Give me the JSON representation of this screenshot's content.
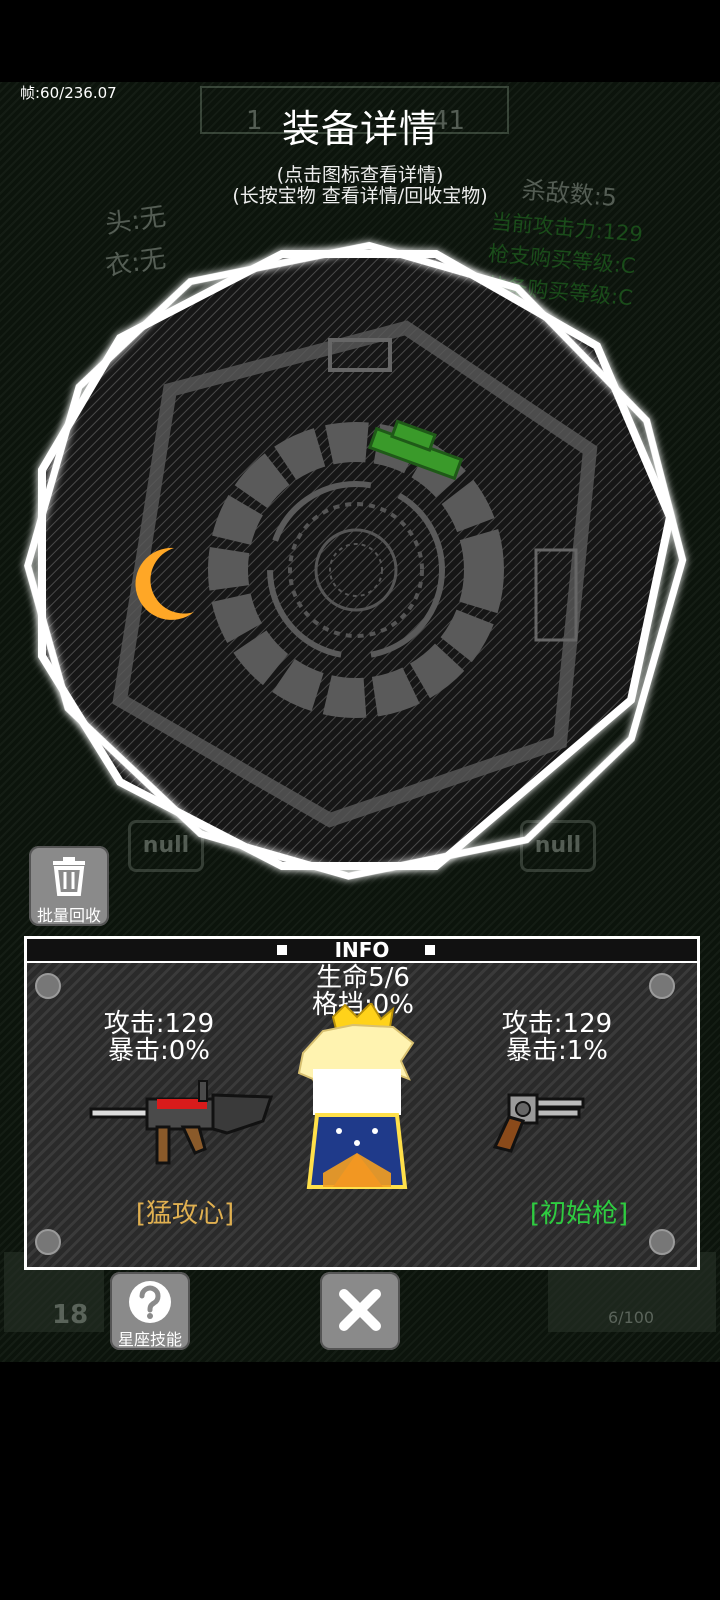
{
  "fps_text": "帧:60/236.07",
  "title": "装备详情",
  "hints": [
    "(点击图标查看详情)",
    "(长按宝物 查看详情/回收宝物)"
  ],
  "background": {
    "top_stats": [
      "1",
      "41"
    ],
    "head_label": "头:无",
    "cloth_label": "衣:无",
    "kill_count": "杀敌数:5",
    "attack_power": "当前攻击力:129",
    "gun_upgrade": "枪支购买等级:C",
    "equip_upgrade": "装备购买等级:C",
    "slot_labels": [
      "null",
      "null",
      "null"
    ],
    "ammo_count": "18",
    "progress": "6/100"
  },
  "recycle_button": {
    "label": "批量回收",
    "icon": "trash-icon"
  },
  "info": {
    "title": "INFO",
    "hp": "生命5/6",
    "block": "格挡:0%",
    "left_weapon": {
      "attack": "攻击:129",
      "crit": "暴击:0%",
      "name": "[猛攻心]",
      "name_color": "#e0b050"
    },
    "right_weapon": {
      "attack": "攻击:129",
      "crit": "暴击:1%",
      "name": "[初始枪]",
      "name_color": "#2ecc40"
    }
  },
  "skill_button": {
    "label": "星座技能",
    "icon": "question-icon"
  },
  "close_button": {
    "icon": "close-x-icon"
  },
  "colors": {
    "moon": "#ffa726",
    "hat": "#3a9a2a",
    "accent_gold": "#e0b050",
    "accent_green": "#2ecc40"
  }
}
